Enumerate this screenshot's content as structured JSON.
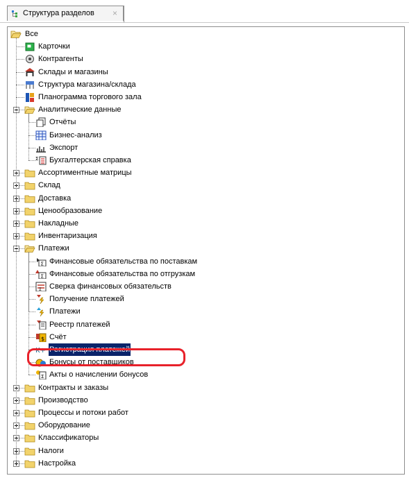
{
  "tab": {
    "label": "Структура разделов",
    "close": "×"
  },
  "tree": {
    "root_label": "Все",
    "items": [
      {
        "label": "Карточки",
        "icon": "cards-icon",
        "level": 1
      },
      {
        "label": "Контрагенты",
        "icon": "counterparties-icon",
        "level": 1
      },
      {
        "label": "Склады и магазины",
        "icon": "warehouse-icon",
        "level": 1
      },
      {
        "label": "Структура магазина/склада",
        "icon": "store-structure-icon",
        "level": 1
      },
      {
        "label": "Планограмма торгового зала",
        "icon": "planogram-icon",
        "level": 1
      },
      {
        "label": "Аналитические данные",
        "icon": "folder-open-icon",
        "level": 1,
        "expander": "minus"
      },
      {
        "label": "Отчёты",
        "icon": "reports-icon",
        "level": 2
      },
      {
        "label": "Бизнес-анализ",
        "icon": "business-analysis-icon",
        "level": 2
      },
      {
        "label": "Экспорт",
        "icon": "export-icon",
        "level": 2
      },
      {
        "label": "Бухгалтерская справка",
        "icon": "accounting-note-icon",
        "level": 2
      },
      {
        "label": "Ассортиментные матрицы",
        "icon": "folder-icon",
        "level": 1,
        "expander": "plus"
      },
      {
        "label": "Склад",
        "icon": "folder-icon",
        "level": 1,
        "expander": "plus"
      },
      {
        "label": "Доставка",
        "icon": "folder-icon",
        "level": 1,
        "expander": "plus"
      },
      {
        "label": "Ценообразование",
        "icon": "folder-icon",
        "level": 1,
        "expander": "plus"
      },
      {
        "label": "Накладные",
        "icon": "folder-icon",
        "level": 1,
        "expander": "plus"
      },
      {
        "label": "Инвентаризация",
        "icon": "folder-icon",
        "level": 1,
        "expander": "plus"
      },
      {
        "label": "Платежи",
        "icon": "folder-open-icon",
        "level": 1,
        "expander": "minus"
      },
      {
        "label": "Финансовые обязательства по поставкам",
        "icon": "supply-obligations-icon",
        "level": 2
      },
      {
        "label": "Финансовые обязательства по отгрузкам",
        "icon": "shipment-obligations-icon",
        "level": 2
      },
      {
        "label": "Сверка финансовых обязательств",
        "icon": "reconciliation-icon",
        "level": 2
      },
      {
        "label": "Получение платежей",
        "icon": "receive-payments-icon",
        "level": 2
      },
      {
        "label": "Платежи",
        "icon": "payments-icon",
        "level": 2
      },
      {
        "label": "Реестр платежей",
        "icon": "payment-registry-icon",
        "level": 2
      },
      {
        "label": "Счёт",
        "icon": "invoice-icon",
        "level": 2
      },
      {
        "label": "Регистрация платежей",
        "icon": "k-plus-icon",
        "level": 2,
        "selected": true
      },
      {
        "label": "Бонусы от поставщиков",
        "icon": "supplier-bonus-icon",
        "level": 2
      },
      {
        "label": "Акты о начислении бонусов",
        "icon": "bonus-acts-icon",
        "level": 2
      },
      {
        "label": "Контракты и заказы",
        "icon": "folder-icon",
        "level": 1,
        "expander": "plus"
      },
      {
        "label": "Производство",
        "icon": "folder-icon",
        "level": 1,
        "expander": "plus"
      },
      {
        "label": "Процессы и потоки работ",
        "icon": "folder-icon",
        "level": 1,
        "expander": "plus"
      },
      {
        "label": "Оборудование",
        "icon": "folder-icon",
        "level": 1,
        "expander": "plus"
      },
      {
        "label": "Классификаторы",
        "icon": "folder-icon",
        "level": 1,
        "expander": "plus"
      },
      {
        "label": "Налоги",
        "icon": "folder-icon",
        "level": 1,
        "expander": "plus"
      },
      {
        "label": "Настройка",
        "icon": "folder-icon",
        "level": 1,
        "expander": "plus"
      }
    ]
  },
  "colors": {
    "selection": "#0a246a",
    "annotation_ring": "#e8212a",
    "folder": "#f2d36b"
  }
}
